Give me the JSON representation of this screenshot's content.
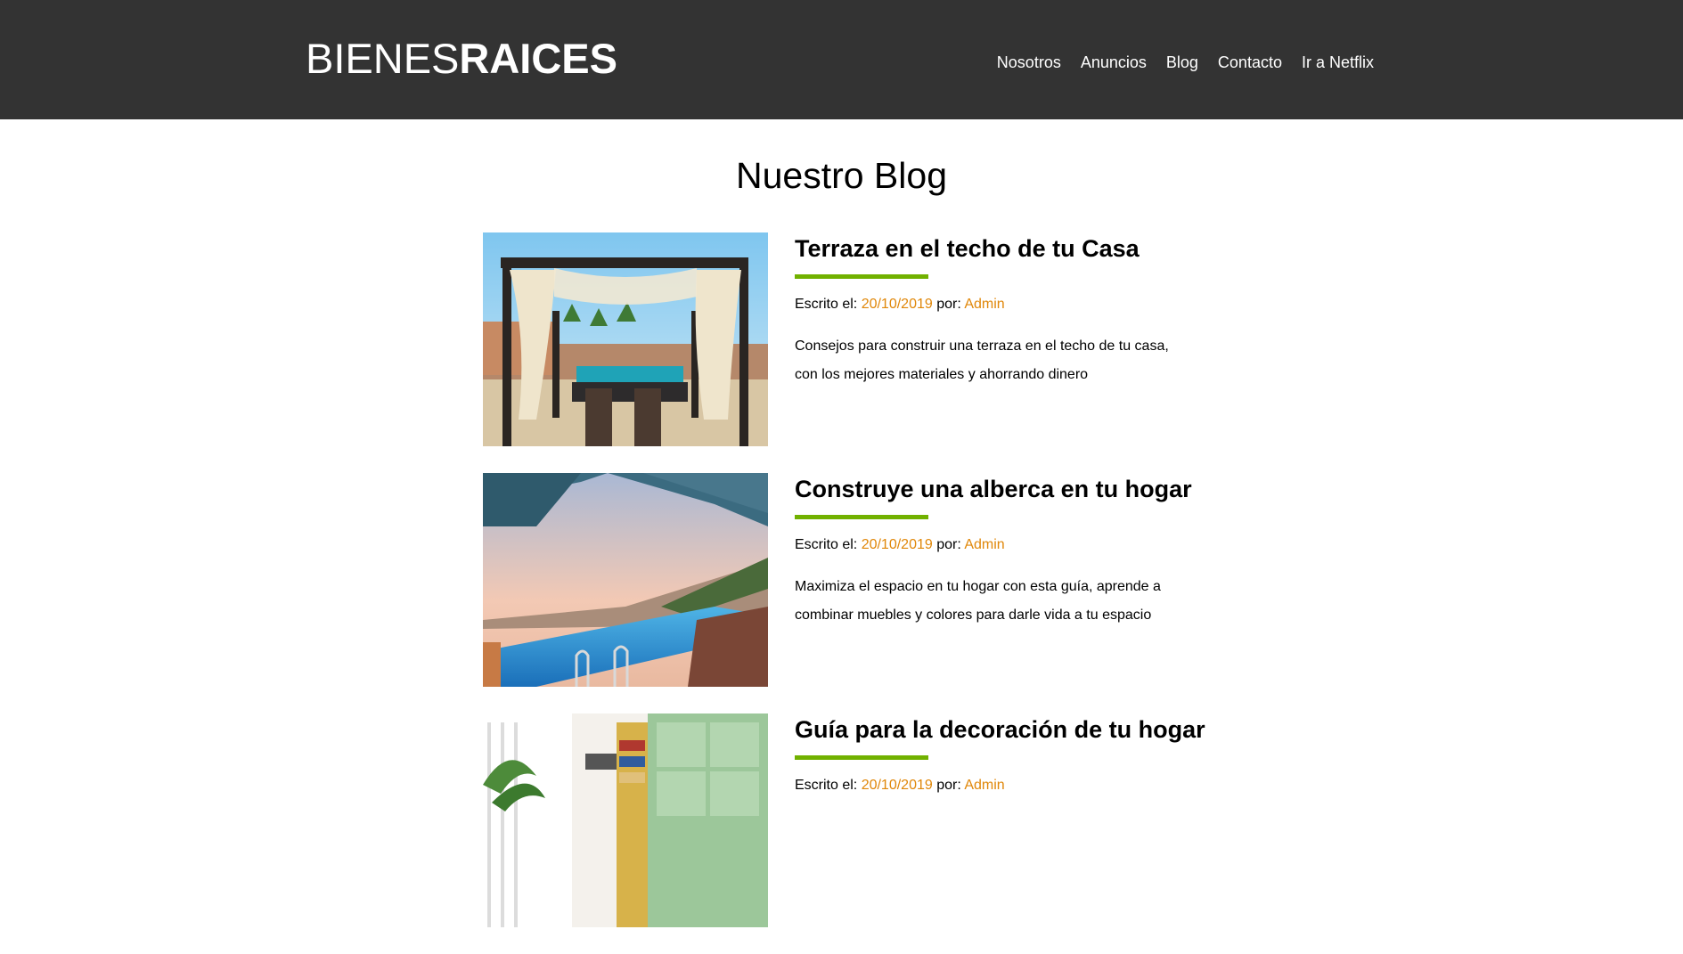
{
  "header": {
    "logo_light": "BIENES",
    "logo_bold": "RAICES",
    "nav": [
      {
        "label": "Nosotros"
      },
      {
        "label": "Anuncios"
      },
      {
        "label": "Blog"
      },
      {
        "label": "Contacto"
      },
      {
        "label": "Ir a Netflix"
      }
    ]
  },
  "page": {
    "title": "Nuestro Blog"
  },
  "colors": {
    "header_bg": "#333333",
    "accent_green": "#71b100",
    "accent_orange": "#e08709"
  },
  "entries": [
    {
      "title": "Terraza en el techo de tu Casa",
      "meta_prefix": "Escrito el: ",
      "date": "20/10/2019",
      "meta_by": " por: ",
      "author": "Admin",
      "excerpt": "Consejos para construir una terraza en el techo de tu casa, con los mejores materiales y ahorrando dinero",
      "image_icon": "rooftop-terrace-photo"
    },
    {
      "title": "Construye una alberca en tu hogar",
      "meta_prefix": "Escrito el: ",
      "date": "20/10/2019",
      "meta_by": " por: ",
      "author": "Admin",
      "excerpt": "Maximiza el espacio en tu hogar con esta guía, aprende a combinar muebles y colores para darle vida a tu espacio",
      "image_icon": "pool-photo"
    },
    {
      "title": "Guía para la decoración de tu hogar",
      "meta_prefix": "Escrito el: ",
      "date": "20/10/2019",
      "meta_by": " por: ",
      "author": "Admin",
      "excerpt": "",
      "image_icon": "interior-decor-photo"
    }
  ]
}
